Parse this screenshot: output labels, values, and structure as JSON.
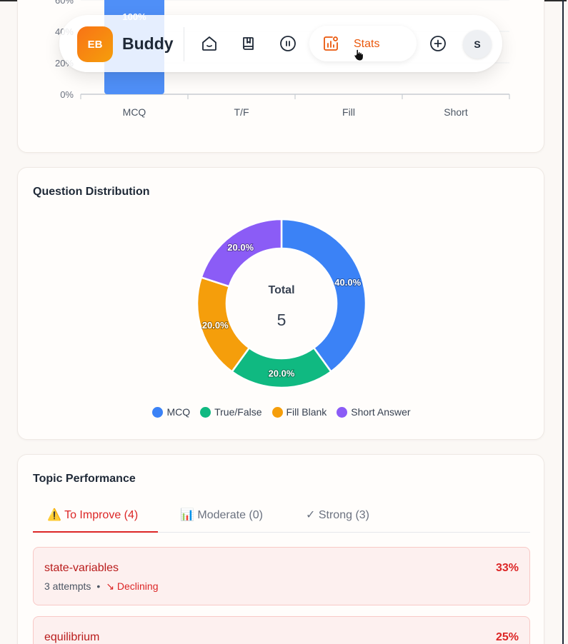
{
  "nav": {
    "logo_initials": "EB",
    "logo_name": "Buddy",
    "stats_label": "Stats",
    "avatar_initial": "S",
    "icons": [
      "home-icon",
      "book-icon",
      "pause-icon",
      "stats-icon",
      "add-icon"
    ]
  },
  "bar_chart": {
    "chart_data": {
      "type": "bar",
      "categories": [
        "MCQ",
        "T/F",
        "Fill",
        "Short"
      ],
      "values": [
        100,
        0,
        0,
        0
      ],
      "y_tick_labels": [
        "0%",
        "20%",
        "40%",
        "60%"
      ],
      "ylim": [
        0,
        60
      ],
      "top_label": "100%",
      "color": "#4f8ff7"
    }
  },
  "distribution": {
    "title": "Question Distribution",
    "center_label": "Total",
    "center_value": "5",
    "chart_data": {
      "type": "pie",
      "labels": [
        "MCQ",
        "True/False",
        "Fill Blank",
        "Short Answer"
      ],
      "values": [
        40.0,
        20.0,
        20.0,
        20.0
      ],
      "value_labels": [
        "40.0%",
        "20.0%",
        "20.0%",
        "20.0%"
      ],
      "colors": [
        "#3b82f6",
        "#10b981",
        "#f59e0b",
        "#8b5cf6"
      ]
    }
  },
  "topics": {
    "title": "Topic Performance",
    "tabs": [
      {
        "icon": "⚠️",
        "label": "To Improve (4)"
      },
      {
        "icon": "📊",
        "label": "Moderate (0)"
      },
      {
        "icon": "✓",
        "label": "Strong (3)"
      }
    ],
    "rows": [
      {
        "name": "state-variables",
        "percent": "33%",
        "attempts": "3 attempts",
        "separator": "•",
        "trend": "↘ Declining"
      },
      {
        "name": "equilibrium",
        "percent": "25%"
      }
    ]
  }
}
